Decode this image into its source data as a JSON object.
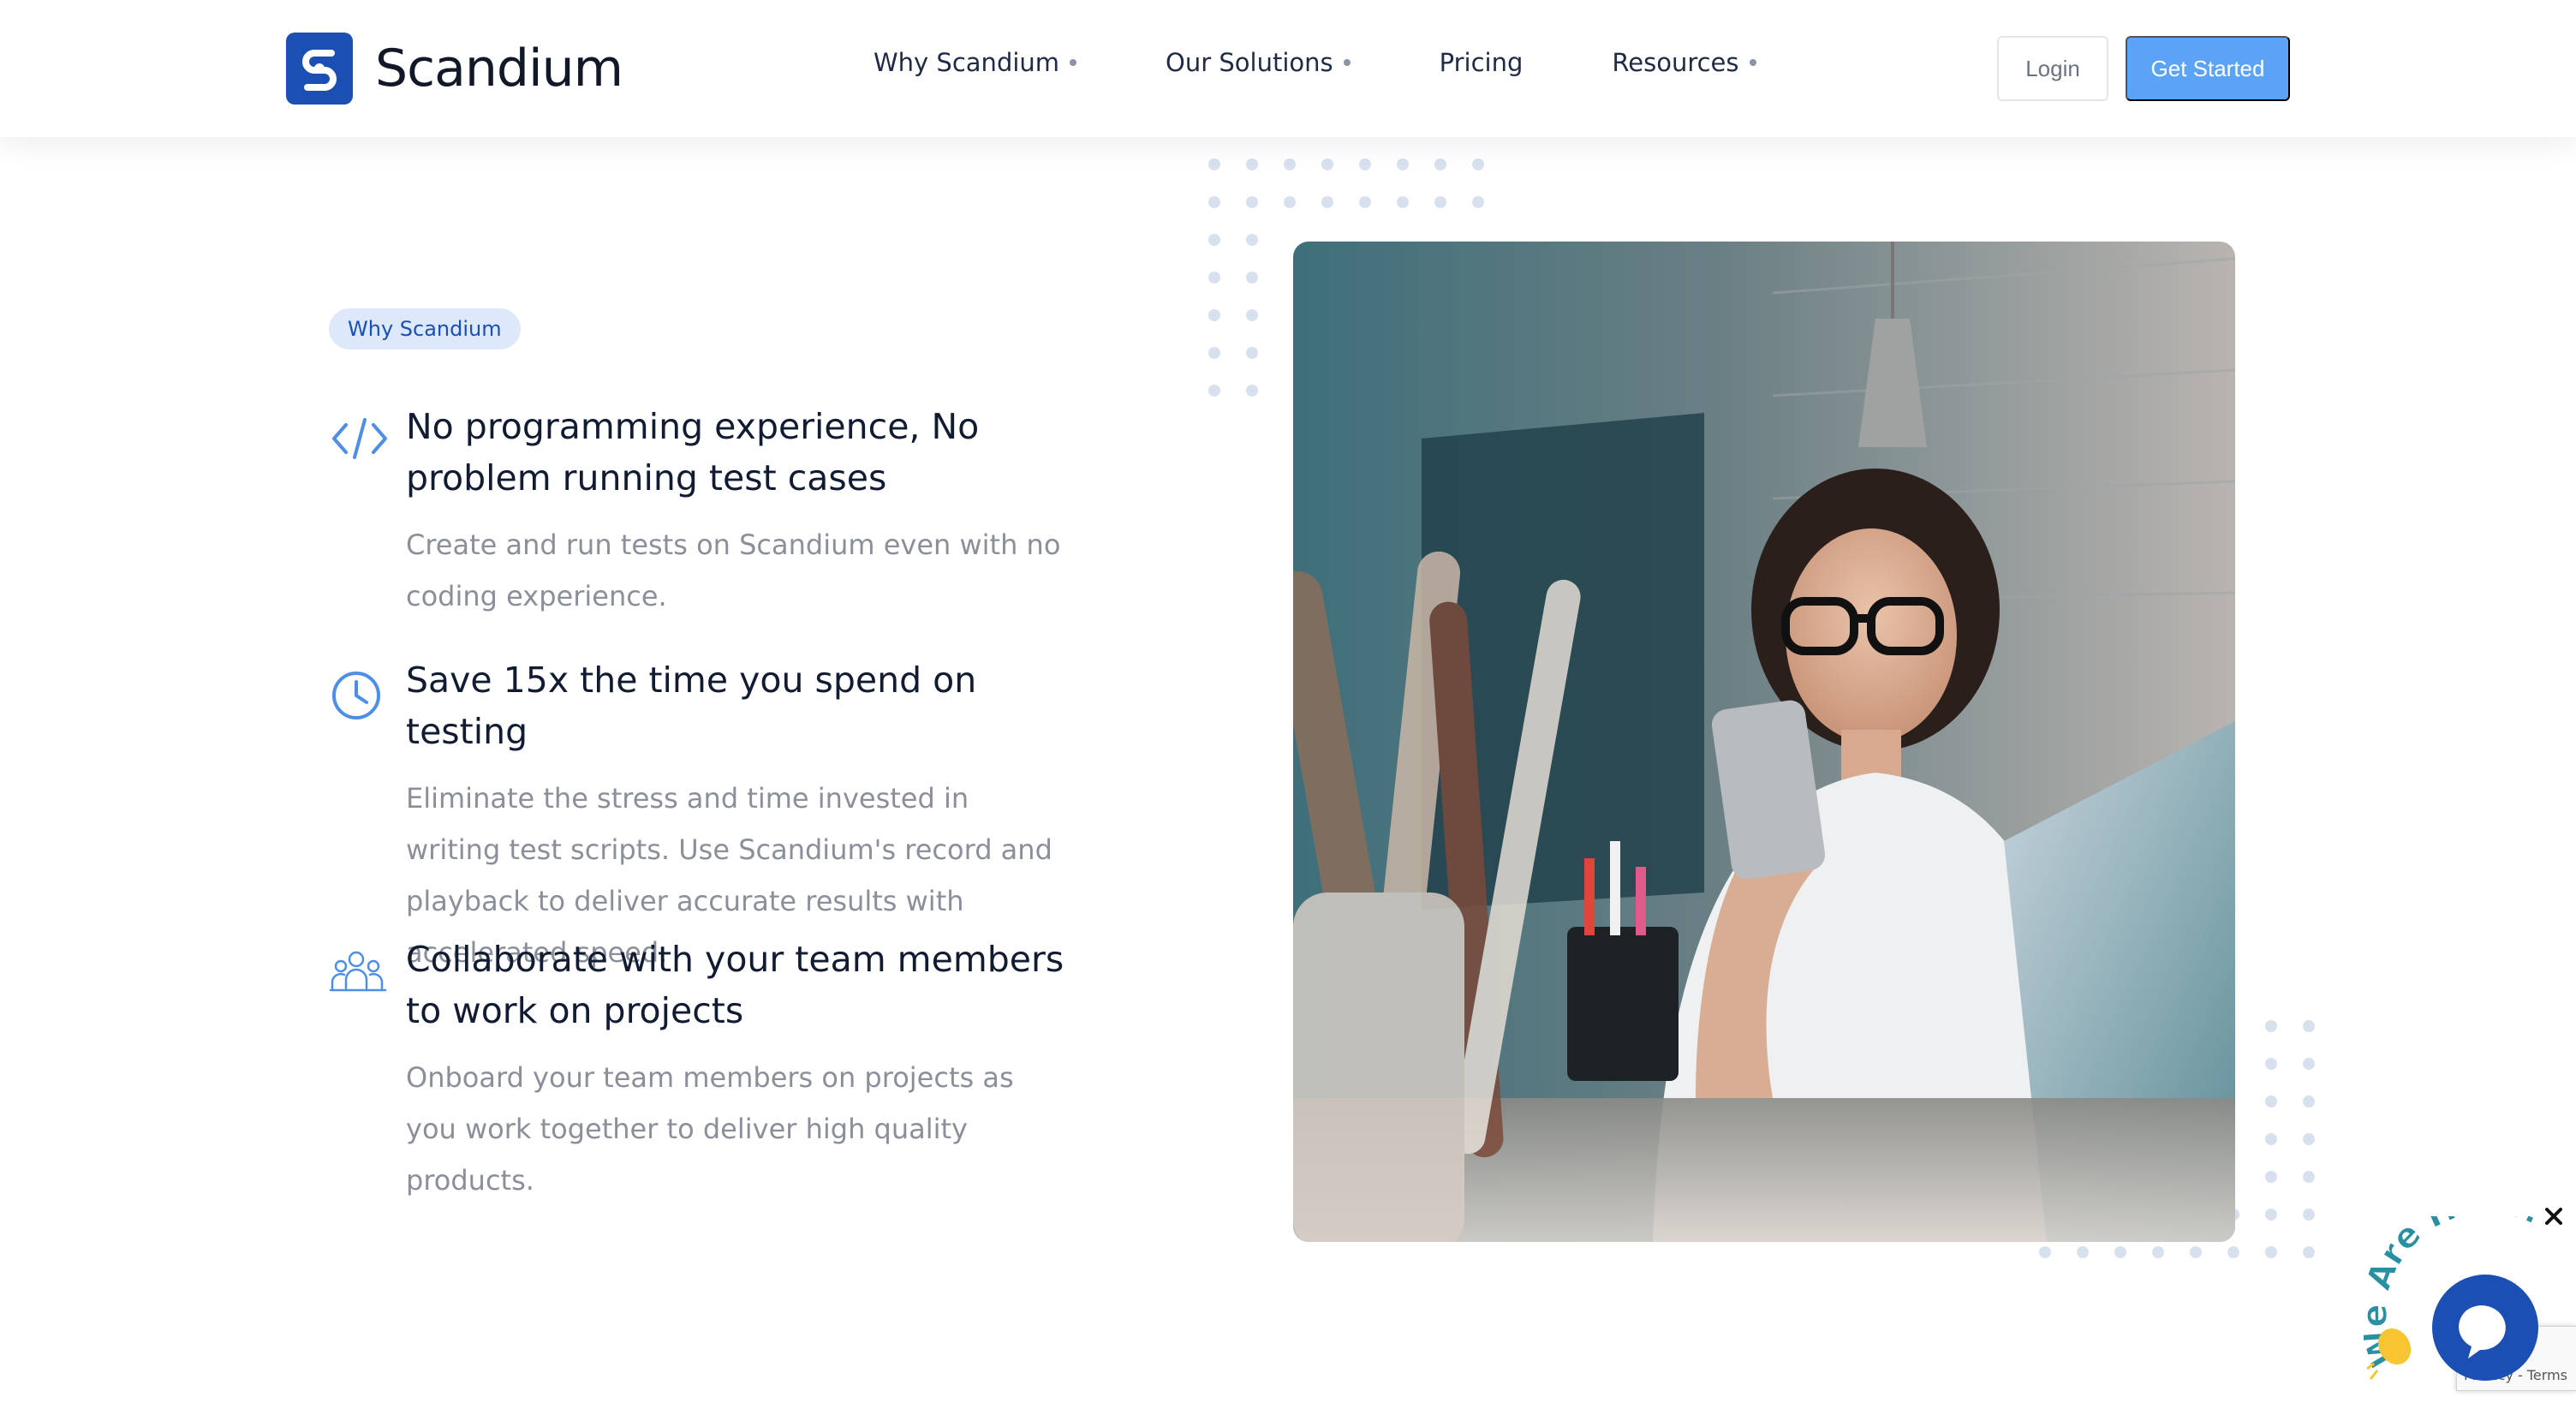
{
  "brand": {
    "name": "Scandium",
    "color": "#1b4fb4"
  },
  "nav": {
    "items": [
      {
        "label": "Why Scandium",
        "has_dropdown": true
      },
      {
        "label": "Our Solutions",
        "has_dropdown": true
      },
      {
        "label": "Pricing",
        "has_dropdown": false
      },
      {
        "label": "Resources",
        "has_dropdown": true
      }
    ],
    "login_label": "Login",
    "cta_label": "Get Started",
    "cta_color": "#5aa3f6"
  },
  "section": {
    "badge": "Why Scandium",
    "features": [
      {
        "icon": "code-icon",
        "title": "No programming experience, No problem running test cases",
        "text": "Create and run tests on Scandium even with no coding experience."
      },
      {
        "icon": "clock-icon",
        "title": "Save 15x the time you spend on testing",
        "text": "Eliminate the stress and time invested in writing test scripts. Use Scandium's record and playback to deliver accurate results with accelerated speed."
      },
      {
        "icon": "team-icon",
        "title": "Collaborate with your team members to work on projects",
        "text": "Onboard your team members on projects as you work together to deliver high quality products."
      }
    ]
  },
  "chat": {
    "badge_text": "We Are Here!",
    "wave_icon": "waving-hand-icon"
  },
  "recaptcha": {
    "text": "Privacy - Terms"
  }
}
